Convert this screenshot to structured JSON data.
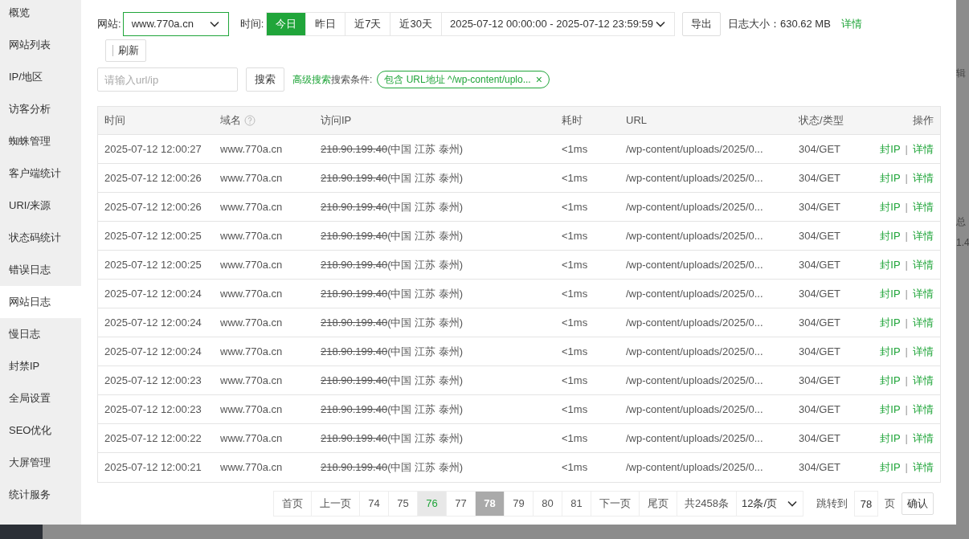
{
  "sidebar": {
    "items": [
      {
        "label": "概览",
        "selected": false
      },
      {
        "label": "网站列表",
        "selected": false
      },
      {
        "label": "IP/地区",
        "selected": false
      },
      {
        "label": "访客分析",
        "selected": false
      },
      {
        "label": "蜘蛛管理",
        "selected": false
      },
      {
        "label": "客户端统计",
        "selected": false
      },
      {
        "label": "URI/来源",
        "selected": false
      },
      {
        "label": "状态码统计",
        "selected": false
      },
      {
        "label": "错误日志",
        "selected": false
      },
      {
        "label": "网站日志",
        "selected": true
      },
      {
        "label": "慢日志",
        "selected": false
      },
      {
        "label": "封禁IP",
        "selected": false
      },
      {
        "label": "全局设置",
        "selected": false
      },
      {
        "label": "SEO优化",
        "selected": false
      },
      {
        "label": "大屏管理",
        "selected": false
      },
      {
        "label": "统计服务",
        "selected": false
      }
    ]
  },
  "toolbar": {
    "site_label": "网站:",
    "site_value": "www.770a.cn",
    "time_label": "时间:",
    "time_tabs": [
      {
        "label": "今日",
        "selected": true
      },
      {
        "label": "昨日",
        "selected": false
      },
      {
        "label": "近7天",
        "selected": false
      },
      {
        "label": "近30天",
        "selected": false
      }
    ],
    "date_range": "2025-07-12 00:00:00 - 2025-07-12 23:59:59",
    "export": "导出",
    "log_size": "日志大小：630.62 MB",
    "details_link": "详情",
    "refresh": "刷新"
  },
  "search": {
    "placeholder": "请输入url/ip",
    "button": "搜索",
    "advanced": "高级搜索",
    "conditions_label": "搜索条件:",
    "filter_tag": "包含 URL地址 ^/wp-content/uplo...",
    "filter_close": "×"
  },
  "table": {
    "columns": [
      "时间",
      "域名",
      "访问IP",
      "耗时",
      "URL",
      "状态/类型",
      "操作"
    ],
    "rows": [
      {
        "time": "2025-07-12 12:00:27",
        "domain": "www.770a.cn",
        "ip": "218.90.199.40",
        "ip_struck": true,
        "location": "(中国 江苏 泰州)",
        "duration": "<1ms",
        "url": "/wp-content/uploads/2025/0...",
        "status": "304/GET",
        "ban": "封IP",
        "sep": "|",
        "details": "详情"
      },
      {
        "time": "2025-07-12 12:00:26",
        "domain": "www.770a.cn",
        "ip": "218.90.199.40",
        "ip_struck": true,
        "location": "(中国 江苏 泰州)",
        "duration": "<1ms",
        "url": "/wp-content/uploads/2025/0...",
        "status": "304/GET",
        "ban": "封IP",
        "sep": "|",
        "details": "详情"
      },
      {
        "time": "2025-07-12 12:00:26",
        "domain": "www.770a.cn",
        "ip": "218.90.199.40",
        "ip_struck": true,
        "location": "(中国 江苏 泰州)",
        "duration": "<1ms",
        "url": "/wp-content/uploads/2025/0...",
        "status": "304/GET",
        "ban": "封IP",
        "sep": "|",
        "details": "详情"
      },
      {
        "time": "2025-07-12 12:00:25",
        "domain": "www.770a.cn",
        "ip": "218.90.199.40",
        "ip_struck": true,
        "location": "(中国 江苏 泰州)",
        "duration": "<1ms",
        "url": "/wp-content/uploads/2025/0...",
        "status": "304/GET",
        "ban": "封IP",
        "sep": "|",
        "details": "详情"
      },
      {
        "time": "2025-07-12 12:00:25",
        "domain": "www.770a.cn",
        "ip": "218.90.199.40",
        "ip_struck": true,
        "location": "(中国 江苏 泰州)",
        "duration": "<1ms",
        "url": "/wp-content/uploads/2025/0...",
        "status": "304/GET",
        "ban": "封IP",
        "sep": "|",
        "details": "详情"
      },
      {
        "time": "2025-07-12 12:00:24",
        "domain": "www.770a.cn",
        "ip": "218.90.199.40",
        "ip_struck": true,
        "location": "(中国 江苏 泰州)",
        "duration": "<1ms",
        "url": "/wp-content/uploads/2025/0...",
        "status": "304/GET",
        "ban": "封IP",
        "sep": "|",
        "details": "详情"
      },
      {
        "time": "2025-07-12 12:00:24",
        "domain": "www.770a.cn",
        "ip": "218.90.199.40",
        "ip_struck": true,
        "location": "(中国 江苏 泰州)",
        "duration": "<1ms",
        "url": "/wp-content/uploads/2025/0...",
        "status": "304/GET",
        "ban": "封IP",
        "sep": "|",
        "details": "详情"
      },
      {
        "time": "2025-07-12 12:00:24",
        "domain": "www.770a.cn",
        "ip": "218.90.199.40",
        "ip_struck": true,
        "location": "(中国 江苏 泰州)",
        "duration": "<1ms",
        "url": "/wp-content/uploads/2025/0...",
        "status": "304/GET",
        "ban": "封IP",
        "sep": "|",
        "details": "详情"
      },
      {
        "time": "2025-07-12 12:00:23",
        "domain": "www.770a.cn",
        "ip": "218.90.199.40",
        "ip_struck": true,
        "location": "(中国 江苏 泰州)",
        "duration": "<1ms",
        "url": "/wp-content/uploads/2025/0...",
        "status": "304/GET",
        "ban": "封IP",
        "sep": "|",
        "details": "详情"
      },
      {
        "time": "2025-07-12 12:00:23",
        "domain": "www.770a.cn",
        "ip": "218.90.199.40",
        "ip_struck": true,
        "location": "(中国 江苏 泰州)",
        "duration": "<1ms",
        "url": "/wp-content/uploads/2025/0...",
        "status": "304/GET",
        "ban": "封IP",
        "sep": "|",
        "details": "详情"
      },
      {
        "time": "2025-07-12 12:00:22",
        "domain": "www.770a.cn",
        "ip": "218.90.199.40",
        "ip_struck": true,
        "location": "(中国 江苏 泰州)",
        "duration": "<1ms",
        "url": "/wp-content/uploads/2025/0...",
        "status": "304/GET",
        "ban": "封IP",
        "sep": "|",
        "details": "详情"
      },
      {
        "time": "2025-07-12 12:00:21",
        "domain": "www.770a.cn",
        "ip": "218.90.199.40",
        "ip_struck": true,
        "location": "(中国 江苏 泰州)",
        "duration": "<1ms",
        "url": "/wp-content/uploads/2025/0...",
        "status": "304/GET",
        "ban": "封IP",
        "sep": "|",
        "details": "详情"
      }
    ]
  },
  "pagination": {
    "pages": [
      {
        "label": "首页",
        "selected": false,
        "highlighted": false
      },
      {
        "label": "上一页",
        "selected": false,
        "highlighted": false
      },
      {
        "label": "74",
        "selected": false,
        "highlighted": false
      },
      {
        "label": "75",
        "selected": false,
        "highlighted": false
      },
      {
        "label": "76",
        "selected": false,
        "highlighted": true
      },
      {
        "label": "77",
        "selected": false,
        "highlighted": false
      },
      {
        "label": "78",
        "selected": true,
        "highlighted": false
      },
      {
        "label": "79",
        "selected": false,
        "highlighted": false
      },
      {
        "label": "80",
        "selected": false,
        "highlighted": false
      },
      {
        "label": "81",
        "selected": false,
        "highlighted": false
      },
      {
        "label": "下一页",
        "selected": false,
        "highlighted": false
      },
      {
        "label": "尾页",
        "selected": false,
        "highlighted": false
      }
    ],
    "total": "共2458条",
    "page_size": "12条/页",
    "jump_label": "跳转到",
    "jump_value": "78",
    "page_unit": "页",
    "confirm": "确认"
  },
  "background": {
    "fragments": [
      "辑",
      "总",
      "1.4"
    ]
  }
}
